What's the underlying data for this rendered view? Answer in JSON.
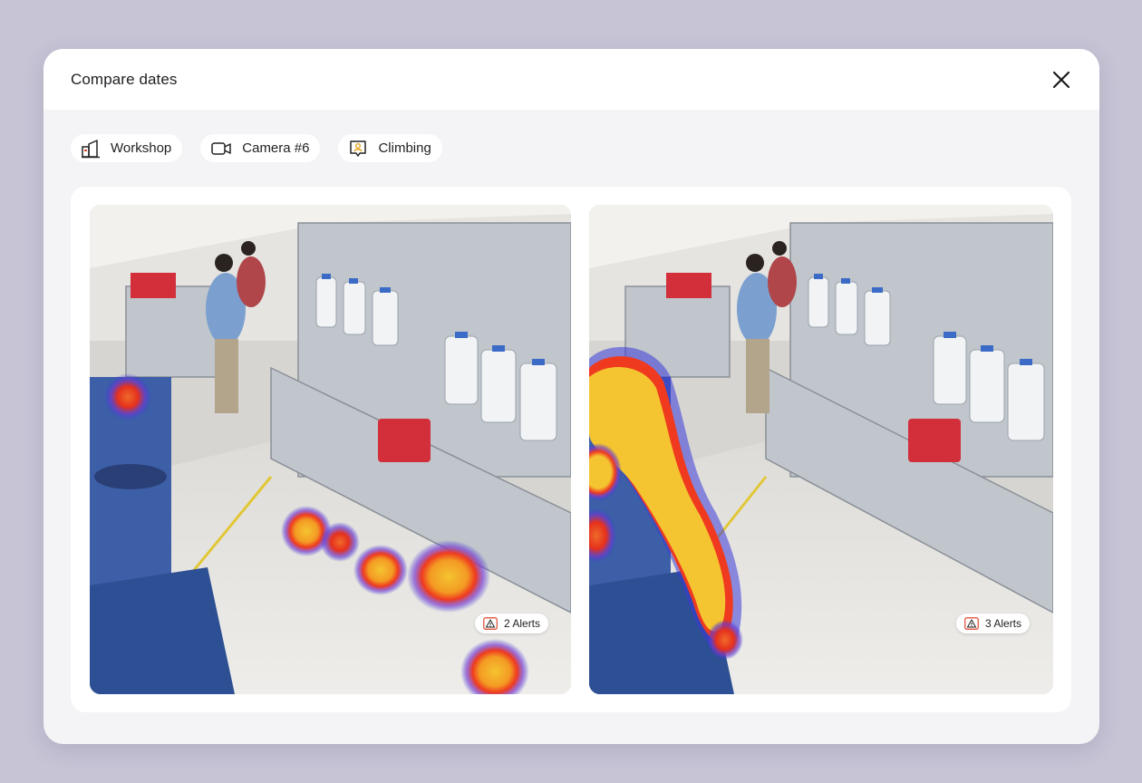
{
  "modal": {
    "title": "Compare dates"
  },
  "filters": [
    {
      "label": "Workshop",
      "icon": "building-icon"
    },
    {
      "label": "Camera #6",
      "icon": "camera-icon"
    },
    {
      "label": "Climbing",
      "icon": "person-badge-icon"
    }
  ],
  "feeds": [
    {
      "alerts_label": "2 Alerts",
      "heatmap_intensity": "low"
    },
    {
      "alerts_label": "3 Alerts",
      "heatmap_intensity": "high"
    }
  ],
  "colors": {
    "backdrop": "#c7c4d6",
    "alert_icon": "#e2452f",
    "heat_hot": "#f5c431",
    "heat_warm": "#ef3a1f",
    "heat_cool": "#3a3ad8"
  }
}
